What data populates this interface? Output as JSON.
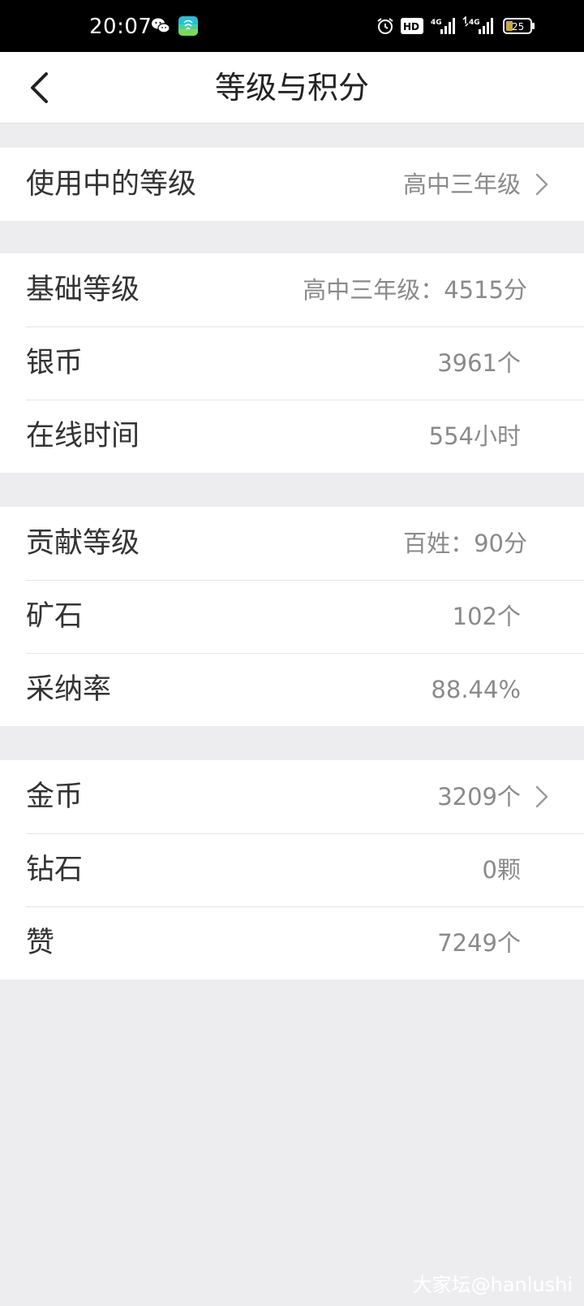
{
  "status_bar": {
    "time": "20:07",
    "network_1": "4G",
    "network_2": "4G",
    "hd": "HD",
    "battery": "25",
    "icons": [
      "wechat-icon",
      "app-icon",
      "alarm-icon",
      "hd-icon",
      "signal-icon",
      "signal-icon",
      "battery-icon"
    ]
  },
  "header": {
    "title": "等级与积分",
    "back_icon": "chevron-left-icon"
  },
  "groups": [
    {
      "rows": [
        {
          "label": "使用中的等级",
          "value": "高中三年级",
          "has_chevron": true
        }
      ]
    },
    {
      "rows": [
        {
          "label": "基础等级",
          "value": "高中三年级：4515分",
          "has_chevron": false
        },
        {
          "label": "银币",
          "value": "3961个",
          "has_chevron": false
        },
        {
          "label": "在线时间",
          "value": "554小时",
          "has_chevron": false
        }
      ]
    },
    {
      "rows": [
        {
          "label": "贡献等级",
          "value": "百姓：90分",
          "has_chevron": false
        },
        {
          "label": "矿石",
          "value": "102个",
          "has_chevron": false
        },
        {
          "label": "采纳率",
          "value": "88.44%",
          "has_chevron": false
        }
      ]
    },
    {
      "rows": [
        {
          "label": "金币",
          "value": "3209个",
          "has_chevron": true
        },
        {
          "label": "钻石",
          "value": "0颗",
          "has_chevron": false
        },
        {
          "label": "赞",
          "value": "7249个",
          "has_chevron": false
        }
      ]
    }
  ],
  "watermark": "大家坛@hanlushi",
  "colors": {
    "background": "#ededf0",
    "card": "#ffffff",
    "label": "#333333",
    "value": "#8a8a8a",
    "status_bar": "#000000",
    "app_icon_accent": "#22c3d6"
  }
}
